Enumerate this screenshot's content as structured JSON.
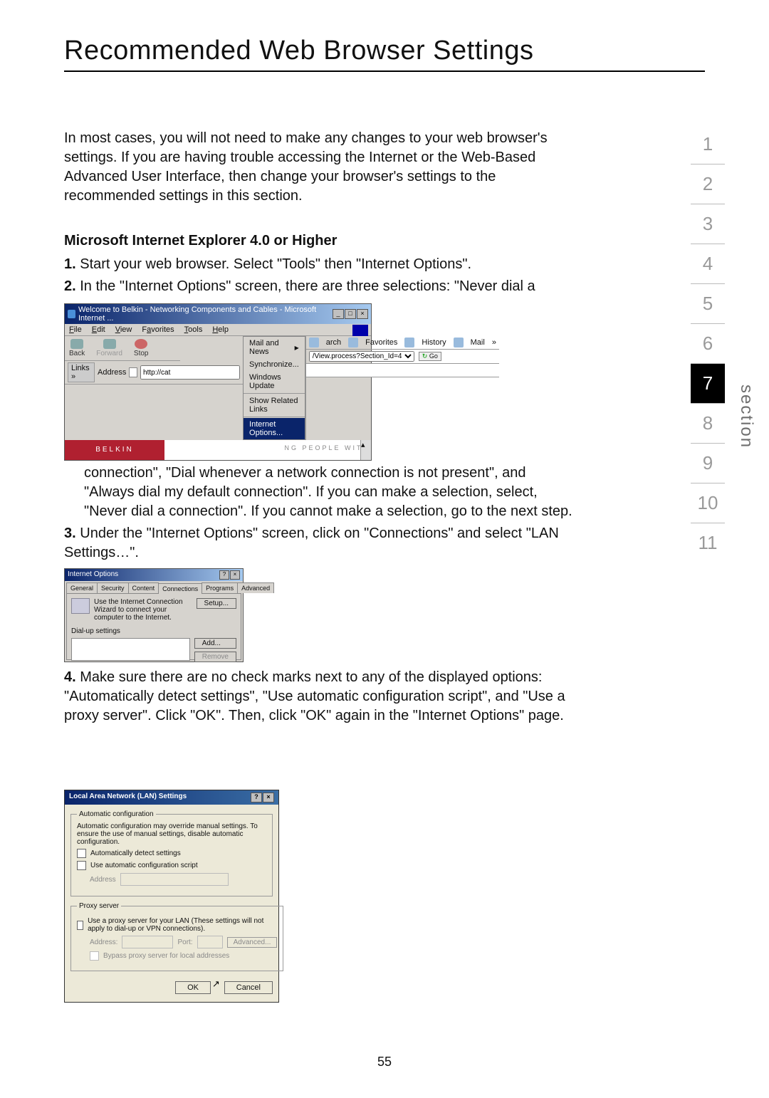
{
  "title": "Recommended Web Browser Settings",
  "intro": "In most cases, you will not need to make any changes to your web browser's settings. If you are having trouble accessing the Internet or the Web-Based Advanced User Interface, then change your browser's settings to the recommended settings in this section.",
  "subhead": "Microsoft Internet Explorer 4.0 or Higher",
  "steps": {
    "s1": "Start your web browser. Select \"Tools\" then \"Internet Options\".",
    "s2": "In the \"Internet Options\" screen, there are three selections: \"Never dial a",
    "s2_cont": "connection\", \"Dial whenever a network connection is not present\", and \"Always dial my default connection\". If you can make a selection, select, \"Never dial a connection\". If you cannot make a selection, go to the next step.",
    "s3": "Under the \"Internet Options\" screen, click on \"Connections\" and select \"LAN Settings…\".",
    "s4": "Make sure there are no check marks next to any of the displayed options: \"Automatically detect settings\", \"Use automatic configuration script\", and \"Use a proxy server\". Click \"OK\". Then, click \"OK\" again in the \"Internet Options\" page."
  },
  "nums": {
    "n1": "1.",
    "n2": "2.",
    "n3": "3.",
    "n4": "4."
  },
  "section_nav": {
    "items": [
      "1",
      "2",
      "3",
      "4",
      "5",
      "6",
      "7",
      "8",
      "9",
      "10",
      "11"
    ],
    "active_index": 6,
    "label": "section"
  },
  "page_number": "55",
  "ss1": {
    "title": "Welcome to Belkin - Networking Components and Cables - Microsoft Internet ...",
    "menus": {
      "file": "File",
      "edit": "Edit",
      "view": "View",
      "favorites": "Favorites",
      "tools": "Tools",
      "help": "Help"
    },
    "toolbar": {
      "back": "Back",
      "forward": "Forward",
      "stop": "Stop"
    },
    "links": "Links »",
    "address_label": "Address",
    "address_value": "http://cat",
    "tools_menu": {
      "mail_news": "Mail and News",
      "synchronize": "Synchronize...",
      "windows_update": "Windows Update",
      "show_related": "Show Related Links",
      "internet_options": "Internet Options..."
    },
    "right_toolbar": {
      "search": "arch",
      "favorites": "Favorites",
      "history": "History",
      "mail": "Mail"
    },
    "combo": "/View.process?Section_Id=4",
    "go": "Go",
    "belkin": "BELKIN",
    "strip": "NG PEOPLE WITH"
  },
  "ss2": {
    "title": "Internet Options",
    "tabs": {
      "general": "General",
      "security": "Security",
      "content": "Content",
      "connections": "Connections",
      "programs": "Programs",
      "advanced": "Advanced"
    },
    "wizard_text": "Use the Internet Connection Wizard to connect your computer to the Internet.",
    "setup": "Setup...",
    "dialup_label": "Dial-up settings",
    "add": "Add...",
    "remove": "Remove"
  },
  "ss3": {
    "title": "Local Area Network (LAN) Settings",
    "grp_auto": "Automatic configuration",
    "auto_text": "Automatic configuration may override manual settings. To ensure the use of manual settings, disable automatic configuration.",
    "auto_detect": "Automatically detect settings",
    "auto_script": "Use automatic configuration script",
    "address_label": "Address",
    "grp_proxy": "Proxy server",
    "proxy_text": "Use a proxy server for your LAN (These settings will not apply to dial-up or VPN connections).",
    "address2": "Address:",
    "port": "Port:",
    "advanced": "Advanced...",
    "bypass": "Bypass proxy server for local addresses",
    "ok": "OK",
    "cancel": "Cancel"
  }
}
